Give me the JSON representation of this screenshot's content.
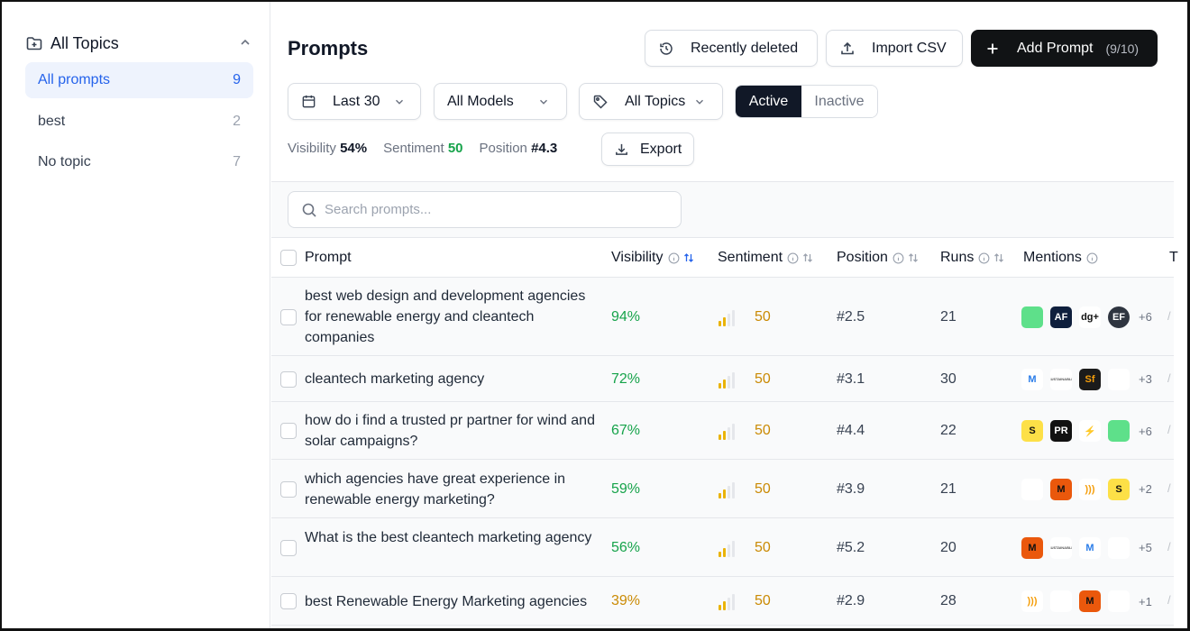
{
  "sidebar": {
    "title": "All Topics",
    "items": [
      {
        "label": "All prompts",
        "count": "9"
      },
      {
        "label": "best",
        "count": "2"
      },
      {
        "label": "No topic",
        "count": "7"
      }
    ]
  },
  "header": {
    "title": "Prompts",
    "recently_deleted": "Recently deleted",
    "import_csv": "Import CSV",
    "add_prompt": "Add Prompt",
    "add_prompt_count": "(9/10)"
  },
  "filters": {
    "date": "Last 30",
    "models": "All Models",
    "topics": "All Topics",
    "active": "Active",
    "inactive": "Inactive"
  },
  "stats": {
    "visibility_label": "Visibility",
    "visibility_value": "54%",
    "sentiment_label": "Sentiment",
    "sentiment_value": "50",
    "position_label": "Position",
    "position_value": "#4.3",
    "export": "Export"
  },
  "search": {
    "placeholder": "Search prompts..."
  },
  "columns": {
    "prompt": "Prompt",
    "visibility": "Visibility",
    "sentiment": "Sentiment",
    "position": "Position",
    "runs": "Runs",
    "mentions": "Mentions",
    "truncated": "T"
  },
  "colors": {
    "green": "#16a34a",
    "amber": "#ca8a04",
    "blue_accent": "#2563eb",
    "dark_button": "#111315"
  },
  "rows": [
    {
      "prompt": "best web design and development agencies for renewable energy and cleantech companies",
      "visibility": "94%",
      "sentiment": "50",
      "position": "#2.5",
      "runs": "21",
      "more": "+6",
      "logos": [
        {
          "icon": "green-square-logo",
          "text": ""
        },
        {
          "icon": "af-logo",
          "text": "AF"
        },
        {
          "icon": "dg-logo",
          "text": "dg+"
        },
        {
          "icon": "ef-logo",
          "text": "EF"
        }
      ]
    },
    {
      "prompt": "cleantech marketing agency",
      "visibility": "72%",
      "sentiment": "50",
      "position": "#3.1",
      "runs": "30",
      "more": "+3",
      "logos": [
        {
          "icon": "m-figure-logo",
          "text": "M"
        },
        {
          "icon": "wordmark-logo",
          "text": "SUSTAINABLE"
        },
        {
          "icon": "sf-logo",
          "text": "Sf"
        },
        {
          "icon": "bird-logo",
          "text": ""
        }
      ]
    },
    {
      "prompt": "how do i find a trusted pr partner for wind and solar campaigns?",
      "visibility": "67%",
      "sentiment": "50",
      "position": "#4.4",
      "runs": "22",
      "more": "+6",
      "logos": [
        {
          "icon": "s-yellow-logo",
          "text": "S"
        },
        {
          "icon": "pr-logo",
          "text": "PR"
        },
        {
          "icon": "bolt-logo",
          "text": "⚡"
        },
        {
          "icon": "green-square-logo",
          "text": ""
        }
      ]
    },
    {
      "prompt": "which agencies have great experience in renewable energy marketing?",
      "visibility": "59%",
      "sentiment": "50",
      "position": "#3.9",
      "runs": "21",
      "more": "+2",
      "logos": [
        {
          "icon": "mascot-logo",
          "text": ""
        },
        {
          "icon": "m-orange-logo",
          "text": "M"
        },
        {
          "icon": "waves-logo",
          "text": ")))"
        },
        {
          "icon": "s-yellow-logo",
          "text": "S"
        }
      ]
    },
    {
      "prompt": "What is the best cleantech marketing agency",
      "visibility": "56%",
      "sentiment": "50",
      "position": "#5.2",
      "runs": "20",
      "more": "+5",
      "logos": [
        {
          "icon": "m-orange-logo",
          "text": "M"
        },
        {
          "icon": "wordmark-logo",
          "text": "SUSTAINABLE"
        },
        {
          "icon": "m-figure-logo",
          "text": "M"
        },
        {
          "icon": "bird-logo",
          "text": ""
        }
      ]
    },
    {
      "prompt": "best Renewable Energy Marketing agencies",
      "visibility": "39%",
      "sentiment": "50",
      "position": "#2.9",
      "runs": "28",
      "more": "+1",
      "logos": [
        {
          "icon": "waves-logo",
          "text": ")))"
        },
        {
          "icon": "swoosh-logo",
          "text": ""
        },
        {
          "icon": "m-orange-logo",
          "text": "M"
        },
        {
          "icon": "mascot-logo",
          "text": ""
        }
      ]
    }
  ]
}
